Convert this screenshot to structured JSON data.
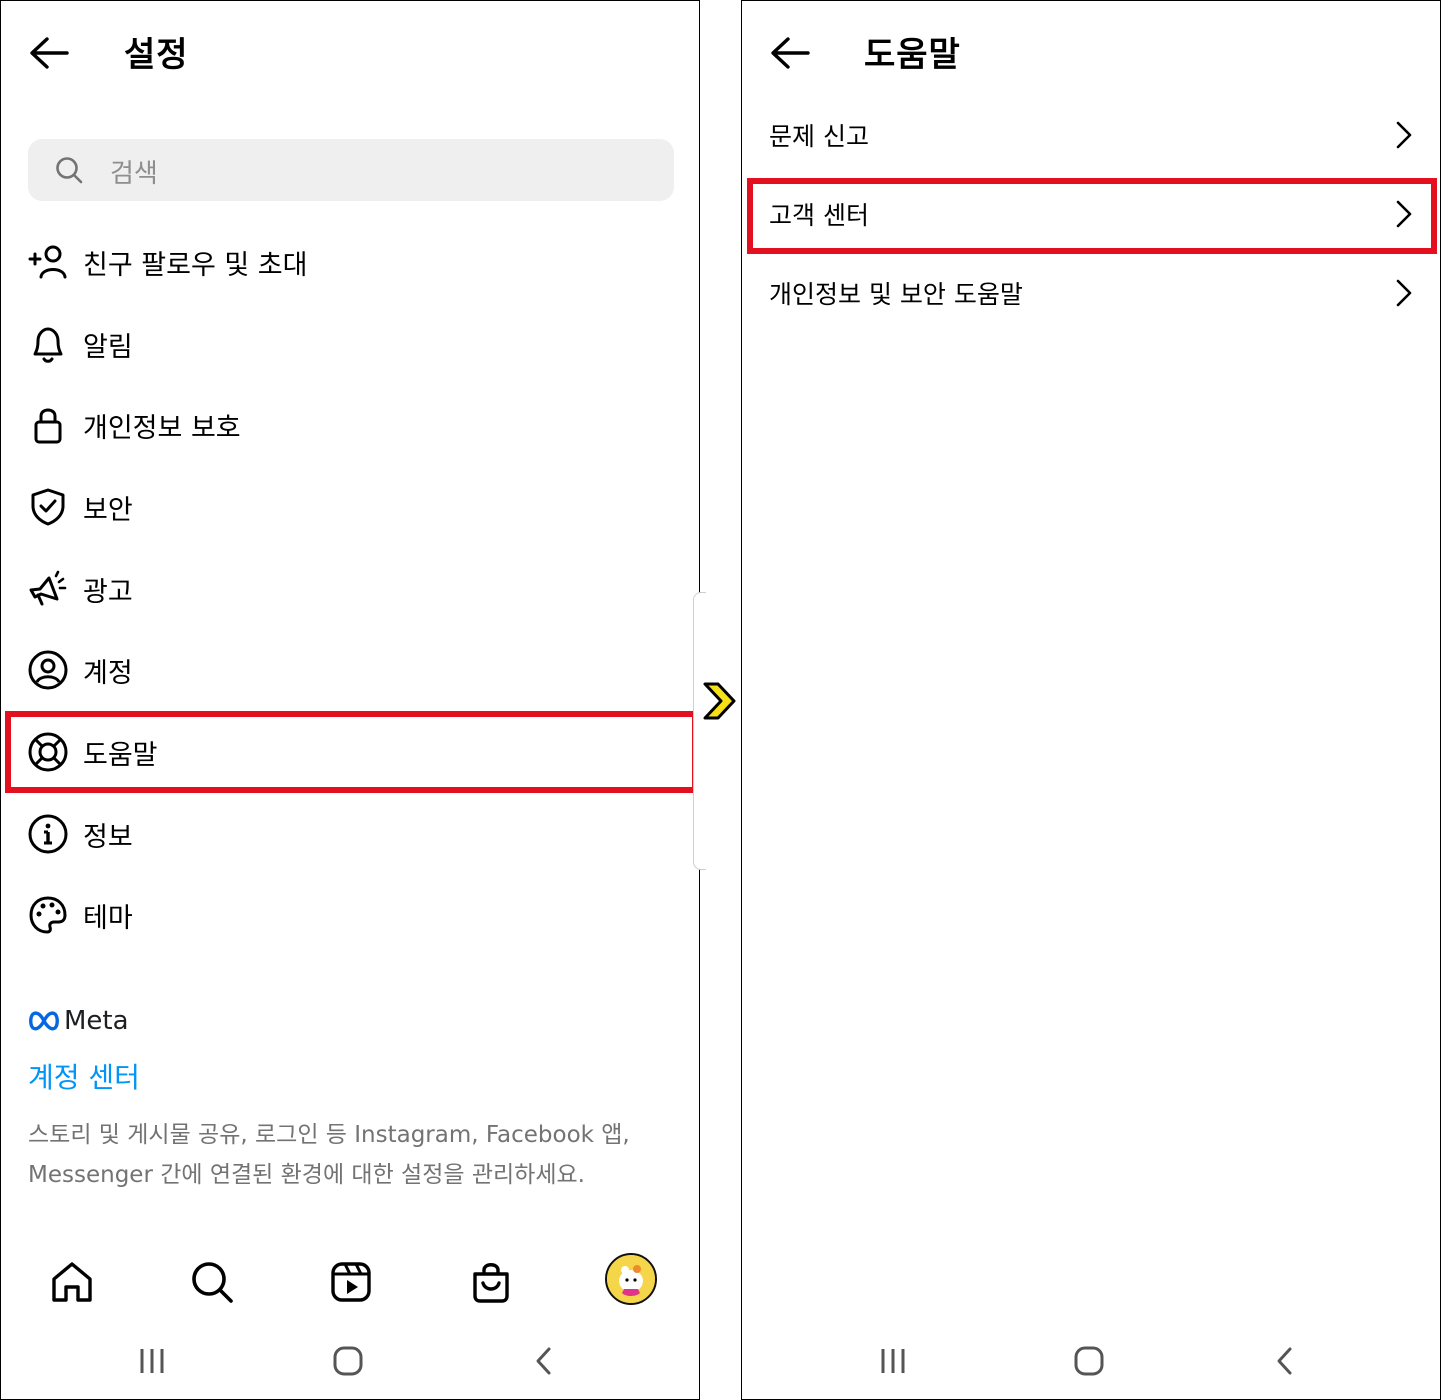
{
  "left": {
    "title": "설정",
    "search_placeholder": "검색",
    "menu": [
      {
        "label": "친구 팔로우 및 초대",
        "icon": "add-person-icon"
      },
      {
        "label": "알림",
        "icon": "bell-icon"
      },
      {
        "label": "개인정보 보호",
        "icon": "lock-icon"
      },
      {
        "label": "보안",
        "icon": "shield-check-icon"
      },
      {
        "label": "광고",
        "icon": "megaphone-icon"
      },
      {
        "label": "계정",
        "icon": "account-circle-icon"
      },
      {
        "label": "도움말",
        "icon": "lifebuoy-icon"
      },
      {
        "label": "정보",
        "icon": "info-icon"
      },
      {
        "label": "테마",
        "icon": "palette-icon"
      }
    ],
    "meta_logo_text": "Meta",
    "accounts_center": "계정 센터",
    "accounts_center_desc": "스토리 및 게시물 공유, 로그인 등 Instagram, Facebook 앱, Messenger 간에 연결된 환경에 대한 설정을 관리하세요.",
    "tabbar": [
      "home-icon",
      "search-icon",
      "reels-icon",
      "shop-icon",
      "profile-avatar"
    ]
  },
  "right": {
    "title": "도움말",
    "items": [
      {
        "label": "문제 신고"
      },
      {
        "label": "고객 센터"
      },
      {
        "label": "개인정보 및 보안 도움말"
      }
    ]
  },
  "colors": {
    "highlight": "#e3111f",
    "link": "#0095f6",
    "search_bg": "#efefef",
    "arrow": "#f7e017"
  }
}
